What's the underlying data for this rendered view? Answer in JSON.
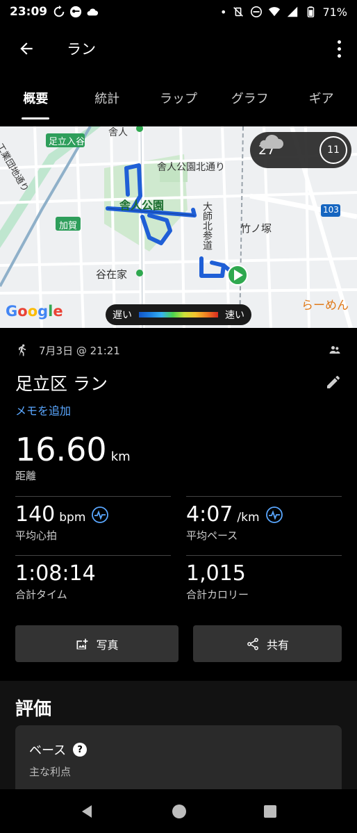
{
  "status": {
    "time": "23:09",
    "battery": "71%"
  },
  "appbar": {
    "title": "ラン"
  },
  "tabs": [
    {
      "label": "概要"
    },
    {
      "label": "統計"
    },
    {
      "label": "ラップ"
    },
    {
      "label": "グラフ"
    },
    {
      "label": "ギア"
    }
  ],
  "map": {
    "labels": {
      "adachi_iriya": "足立入谷",
      "toneri": "舎人",
      "toneri_koen_kita": "舎人公園北通り",
      "toneri_koen": "舎人公園",
      "daishi": "大師北参道",
      "takenotsuka": "竹ノ塚",
      "yazaike": "谷在家",
      "kaga": "加賀",
      "route_103": "103",
      "ramen": "らーめん",
      "industrial": "工業団地通り"
    },
    "weather": {
      "temp": "27°",
      "uv": "11"
    },
    "legend": {
      "slow": "遅い",
      "fast": "速い"
    },
    "google": "Google"
  },
  "activity": {
    "date": "7月3日 @ 21:21",
    "name": "足立区 ラン",
    "add_memo": "メモを追加",
    "distance": {
      "value": "16.60",
      "unit": "km",
      "label": "距離"
    },
    "heart_rate": {
      "value": "140",
      "unit": "bpm",
      "label": "平均心拍"
    },
    "pace": {
      "value": "4:07",
      "unit": "/km",
      "label": "平均ペース"
    },
    "time": {
      "value": "1:08:14",
      "label": "合計タイム"
    },
    "calories": {
      "value": "1,015",
      "label": "合計カロリー"
    }
  },
  "buttons": {
    "photo": "写真",
    "share": "共有"
  },
  "evaluation": {
    "title": "評価",
    "card_title": "ベース",
    "card_sub": "主な利点"
  },
  "colors": {
    "accent": "#5aa7ff",
    "route": "#1f5fd6",
    "start_marker": "#2fa84f"
  }
}
